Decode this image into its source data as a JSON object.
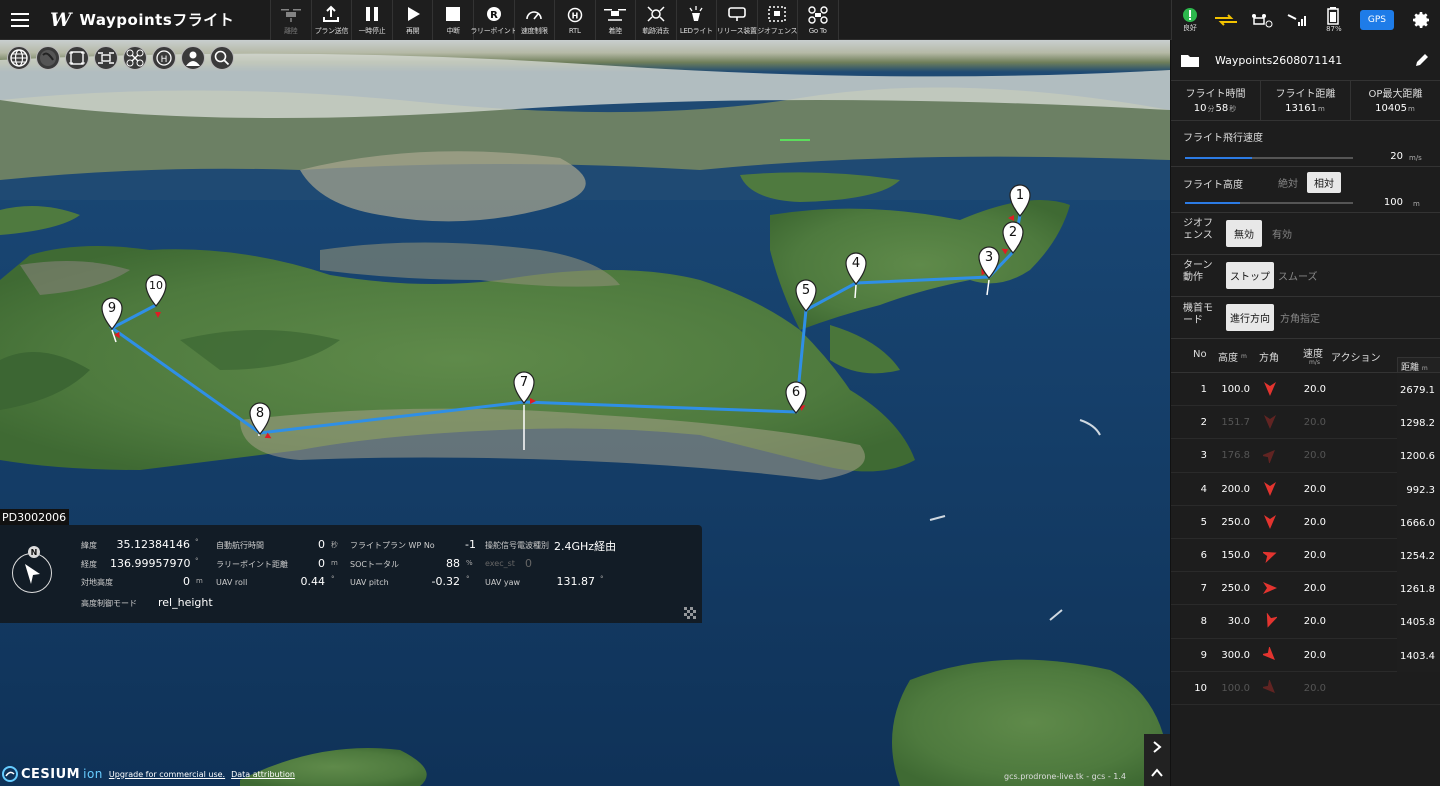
{
  "app": {
    "logo": "W",
    "title": "Waypointsフライト"
  },
  "toolbar": [
    {
      "name": "takeoff",
      "label": "離陸",
      "icon": "drone-takeoff-icon",
      "disabled": true
    },
    {
      "name": "plan-send",
      "label": "プラン送信",
      "icon": "upload-icon"
    },
    {
      "name": "pause",
      "label": "一時停止",
      "icon": "pause-icon"
    },
    {
      "name": "resume",
      "label": "再開",
      "icon": "play-icon"
    },
    {
      "name": "abort",
      "label": "中断",
      "icon": "stop-icon"
    },
    {
      "name": "rally-point",
      "label": "ラリーポイント",
      "icon": "rally-point-icon"
    },
    {
      "name": "speed-limit",
      "label": "速度制限",
      "icon": "speedometer-icon"
    },
    {
      "name": "rtl",
      "label": "RTL",
      "icon": "rtl-icon"
    },
    {
      "name": "land",
      "label": "着陸",
      "icon": "drone-land-icon"
    },
    {
      "name": "clear-track",
      "label": "軌跡消去",
      "icon": "clear-track-icon"
    },
    {
      "name": "led-light",
      "label": "LEDライト",
      "icon": "led-light-icon"
    },
    {
      "name": "release-device",
      "label": "リリース装置",
      "icon": "release-device-icon"
    },
    {
      "name": "geofence",
      "label": "ジオフェンス",
      "icon": "geofence-icon"
    },
    {
      "name": "goto",
      "label": "Go To",
      "icon": "goto-icon"
    }
  ],
  "status": {
    "health": "良好",
    "battery": "87",
    "gps": "GPS"
  },
  "map_tools": [
    "globe-icon",
    "dark-globe-icon",
    "frame-icon",
    "drone-view-icon",
    "drone-icon",
    "home-icon",
    "user-location-icon",
    "search-icon"
  ],
  "waypoints": [
    "1",
    "2",
    "3",
    "4",
    "5",
    "6",
    "7",
    "8",
    "9",
    "10"
  ],
  "telemetry": {
    "drone_id": "PD3002006",
    "lat_label": "緯度",
    "lat": "35.12384146",
    "lat_unit": "°",
    "lon_label": "経度",
    "lon": "136.99957970",
    "lon_unit": "°",
    "agl_label": "対地高度",
    "agl": "0",
    "agl_unit": "m",
    "altmode_label": "高度制御モード",
    "altmode": "rel_height",
    "auto_time_label": "自動航行時間",
    "auto_time": "0",
    "auto_time_unit": "秒",
    "rally_dist_label": "ラリーポイント距離",
    "rally_dist": "0",
    "rally_dist_unit": "m",
    "roll_label": "UAV roll",
    "roll": "0.44",
    "roll_unit": "°",
    "wpno_label": "フライトプラン WP No",
    "wpno": "-1",
    "soc_label": "SOCトータル",
    "soc": "88",
    "soc_unit": "%",
    "pitch_label": "UAV pitch",
    "pitch": "-0.32",
    "pitch_unit": "°",
    "radio_label": "操舵信号電波種別",
    "radio": "2.4GHz経由",
    "exec_label": "exec_st",
    "exec": "0",
    "yaw_label": "UAV yaw",
    "yaw": "131.87",
    "yaw_unit": "°"
  },
  "attribution": {
    "cesium": "CESIUM",
    "ion": "ion",
    "upgrade": "Upgrade for commercial use.",
    "data": "Data attribution",
    "host": "gcs.prodrone-live.tk - gcs - 1.4"
  },
  "panel": {
    "plan_name": "Waypoints2608071141",
    "flight_time_label": "フライト時間",
    "flight_time_min": "10",
    "min_unit": "分",
    "flight_time_sec": "58",
    "sec_unit": "秒",
    "flight_dist_label": "フライト距離",
    "flight_dist": "13161",
    "dist_unit": "m",
    "op_max_label": "OP最大距離",
    "op_max": "10405",
    "op_unit": "m",
    "speed_label": "フライト飛行速度",
    "speed": "20",
    "speed_unit": "m/s",
    "speed_fill": 0.4,
    "alt_label": "フライト高度",
    "alt_abs": "絶対",
    "alt_rel": "相対",
    "alt": "100",
    "alt_unit": "m",
    "alt_fill": 0.33,
    "geofence_label": "ジオフェンス",
    "geofence_off": "無効",
    "geofence_on": "有効",
    "turn_label": "ターン動作",
    "turn_stop": "ストップ",
    "turn_smooth": "スムーズ",
    "heading_label": "機首モード",
    "heading_dir": "進行方向",
    "heading_fixed": "方角指定"
  },
  "table": {
    "headers": {
      "no": "No",
      "alt": "高度",
      "alt_unit": "m",
      "dir": "方角",
      "speed": "速度",
      "speed_unit": "m/s",
      "action": "アクション",
      "dist": "距離",
      "dist_unit": "m"
    },
    "rows": [
      {
        "no": "1",
        "alt": "100.0",
        "speed": "20.0",
        "heading": 180,
        "faded": false
      },
      {
        "no": "2",
        "alt": "151.7",
        "speed": "20.0",
        "heading": 180,
        "faded": true
      },
      {
        "no": "3",
        "alt": "176.8",
        "speed": "20.0",
        "heading": 45,
        "faded": true
      },
      {
        "no": "4",
        "alt": "200.0",
        "speed": "20.0",
        "heading": 180,
        "faded": false
      },
      {
        "no": "5",
        "alt": "250.0",
        "speed": "20.0",
        "heading": 180,
        "faded": false
      },
      {
        "no": "6",
        "alt": "150.0",
        "speed": "20.0",
        "heading": 70,
        "faded": false
      },
      {
        "no": "7",
        "alt": "250.0",
        "speed": "20.0",
        "heading": 90,
        "faded": false
      },
      {
        "no": "8",
        "alt": "30.0",
        "speed": "20.0",
        "heading": 200,
        "faded": false
      },
      {
        "no": "9",
        "alt": "300.0",
        "speed": "20.0",
        "heading": 135,
        "faded": false
      },
      {
        "no": "10",
        "alt": "100.0",
        "speed": "20.0",
        "heading": 135,
        "faded": true
      }
    ],
    "distances": [
      "2679.1",
      "1298.2",
      "1200.6",
      "992.3",
      "1666.0",
      "1254.2",
      "1261.8",
      "1405.8",
      "1403.4"
    ]
  }
}
